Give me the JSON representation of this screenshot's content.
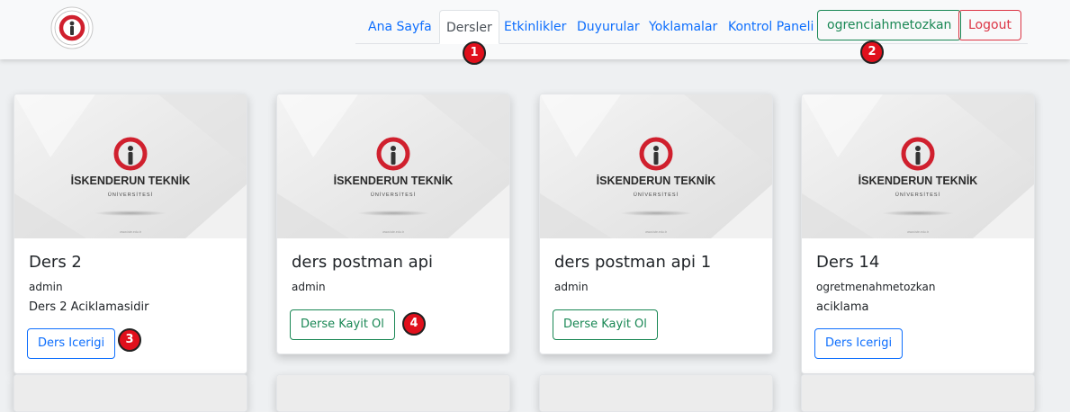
{
  "nav": {
    "brand": "Iskenderun Teknik Universitesi logo",
    "links": [
      "Ana Sayfa",
      "Dersler",
      "Etkinlikler",
      "Duyurular",
      "Yoklamalar",
      "Kontrol Paneli"
    ],
    "active": "Dersler",
    "user_button": "ogrenciahmetozkan",
    "logout_button": "Logout"
  },
  "markers": [
    "1",
    "2",
    "3",
    "4"
  ],
  "card_image": {
    "title": "İSKENDERUN TEKNİK",
    "subtitle": "ÜNİVERSİTESİ",
    "url": "www.iste.edu.tr"
  },
  "courses": [
    {
      "title": "Ders 2",
      "author": "admin",
      "description": "Ders 2 Aciklamasidir",
      "button": "Ders Icerigi"
    },
    {
      "title": "ders postman api",
      "author": "admin",
      "description": "",
      "button": "Derse Kayit Ol"
    },
    {
      "title": "ders postman api 1",
      "author": "admin",
      "description": "",
      "button": "Derse Kayit Ol"
    },
    {
      "title": "Ders 14",
      "author": "ogretmenahmetozkan",
      "description": "aciklama",
      "button": "Ders Icerigi"
    }
  ],
  "colors": {
    "primary": "#0d6efd",
    "success": "#198754",
    "danger": "#dc3545",
    "brand_red": "#d0202e",
    "marker": "#e0101c"
  }
}
